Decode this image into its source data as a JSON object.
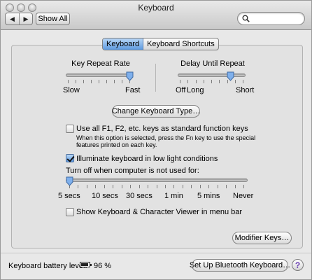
{
  "window": {
    "title": "Keyboard"
  },
  "toolbar": {
    "back_icon": "back-arrow-icon",
    "forward_icon": "forward-arrow-icon",
    "show_all_label": "Show All",
    "search_value": ""
  },
  "tabs": [
    {
      "label": "Keyboard",
      "selected": true
    },
    {
      "label": "Keyboard Shortcuts",
      "selected": false
    }
  ],
  "key_repeat": {
    "label": "Key Repeat Rate",
    "min_label": "Slow",
    "max_label": "Fast",
    "value_fraction": 1.0
  },
  "delay_repeat": {
    "label": "Delay Until Repeat",
    "min_label": "Off",
    "mid_label": "Long",
    "max_label": "Short",
    "value_fraction": 0.8
  },
  "change_type_button": "Change Keyboard Type…",
  "fn_keys": {
    "checked": false,
    "label": "Use all F1, F2, etc. keys as standard function keys",
    "help_line1": "When this option is selected, press the Fn key to use the special",
    "help_line2": "features printed on each key."
  },
  "illuminate": {
    "checked": true,
    "label": "Illuminate keyboard in low light conditions"
  },
  "turn_off": {
    "label": "Turn off when computer is not used for:",
    "ticks": [
      "5 secs",
      "10 secs",
      "30 secs",
      "1 min",
      "5 mins",
      "Never"
    ],
    "value_fraction": 0.0
  },
  "viewer": {
    "checked": false,
    "label": "Show Keyboard & Character Viewer in menu bar"
  },
  "modifier_button": "Modifier Keys…",
  "footer": {
    "battery_label": "Keyboard battery level:",
    "battery_value": "96 %",
    "bluetooth_button": "Set Up Bluetooth Keyboard…",
    "help_symbol": "?"
  },
  "colors": {
    "selected_blue": "#5e9ae0",
    "help_purple": "#6a3fb3"
  }
}
